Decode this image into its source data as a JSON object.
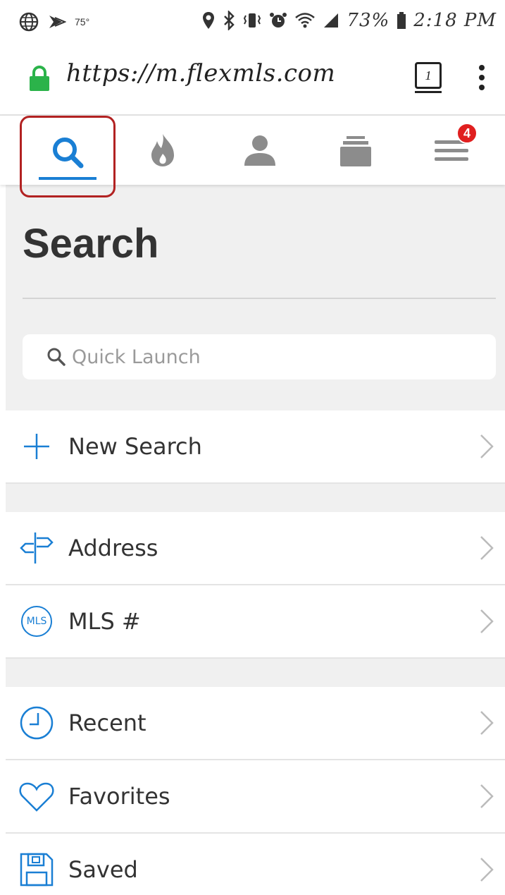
{
  "status_bar": {
    "temperature": "75°",
    "battery": "73%",
    "time": "2:18 PM"
  },
  "browser": {
    "url": "https://m.flexmls.com",
    "tab_count": "1"
  },
  "nav": {
    "items": [
      {
        "name": "search",
        "icon": "search-icon"
      },
      {
        "name": "hot",
        "icon": "flame-icon"
      },
      {
        "name": "contacts",
        "icon": "person-icon"
      },
      {
        "name": "collections",
        "icon": "stack-icon"
      },
      {
        "name": "menu",
        "icon": "hamburger-menu-icon"
      }
    ],
    "menu_badge": "4",
    "active": "search"
  },
  "page": {
    "title": "Search",
    "quick_launch_placeholder": "Quick Launch"
  },
  "list": {
    "new_search": "New Search",
    "address": "Address",
    "mls": "MLS #",
    "mls_icon_text": "MLS",
    "recent": "Recent",
    "favorites": "Favorites",
    "saved": "Saved"
  },
  "colors": {
    "accent": "#1a7fd4",
    "highlight_border": "#b22222",
    "badge": "#e01f1f",
    "lock": "#2bb34a",
    "nav_inactive": "#8c8c8c"
  }
}
